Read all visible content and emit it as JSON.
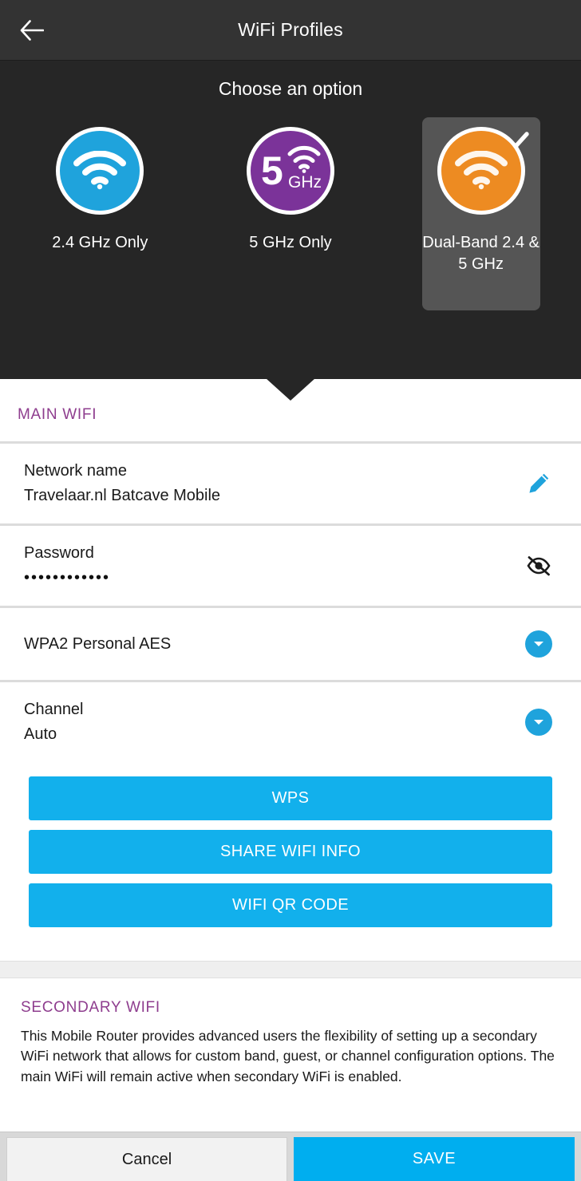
{
  "appbar": {
    "title": "WiFi Profiles",
    "back_icon": "arrow-left-icon"
  },
  "chooser": {
    "title": "Choose an option",
    "options": [
      {
        "label": "2.4 GHz Only",
        "icon": "wifi-icon",
        "color": "#1FA3DC",
        "selected": false
      },
      {
        "label": "5 GHz Only",
        "icon": "wifi-5ghz-icon",
        "badge_text": "5",
        "badge_unit": "GHz",
        "color": "#7B3399",
        "selected": false
      },
      {
        "label": "Dual-Band 2.4 & 5 GHz",
        "icon": "wifi-icon",
        "color": "#ED8B22",
        "selected": true,
        "check_icon": "check-icon"
      }
    ]
  },
  "main_wifi": {
    "heading": "MAIN WIFI",
    "network_name": {
      "label": "Network name",
      "value": "Travelaar.nl Batcave Mobile",
      "action_icon": "pencil-icon"
    },
    "password": {
      "label": "Password",
      "masked_value": "••••••••••••",
      "action_icon": "eye-off-icon"
    },
    "security": {
      "value": "WPA2 Personal AES",
      "action_icon": "chevron-down-icon"
    },
    "channel": {
      "label": "Channel",
      "value": "Auto",
      "action_icon": "chevron-down-icon"
    },
    "buttons": [
      {
        "label": "WPS"
      },
      {
        "label": "SHARE WIFI INFO"
      },
      {
        "label": "WIFI QR CODE"
      }
    ]
  },
  "secondary_wifi": {
    "heading": "SECONDARY WIFI",
    "description": "This Mobile Router provides advanced users the flexibility of setting up a secondary WiFi network that allows for custom band, guest, or channel configuration options. The main WiFi will remain active when secondary WiFi is enabled."
  },
  "bottombar": {
    "cancel_label": "Cancel",
    "save_label": "SAVE"
  },
  "colors": {
    "appbar_bg": "#333333",
    "panel_bg": "#262626",
    "selected_card_bg": "#555555",
    "accent_blue": "#1FA3DC",
    "button_blue": "#12B0EC",
    "save_blue": "#00AEEF",
    "heading_purple": "#8E3D8E",
    "band_24_color": "#1FA3DC",
    "band_5_color": "#7B3399",
    "band_dual_color": "#ED8B22"
  }
}
